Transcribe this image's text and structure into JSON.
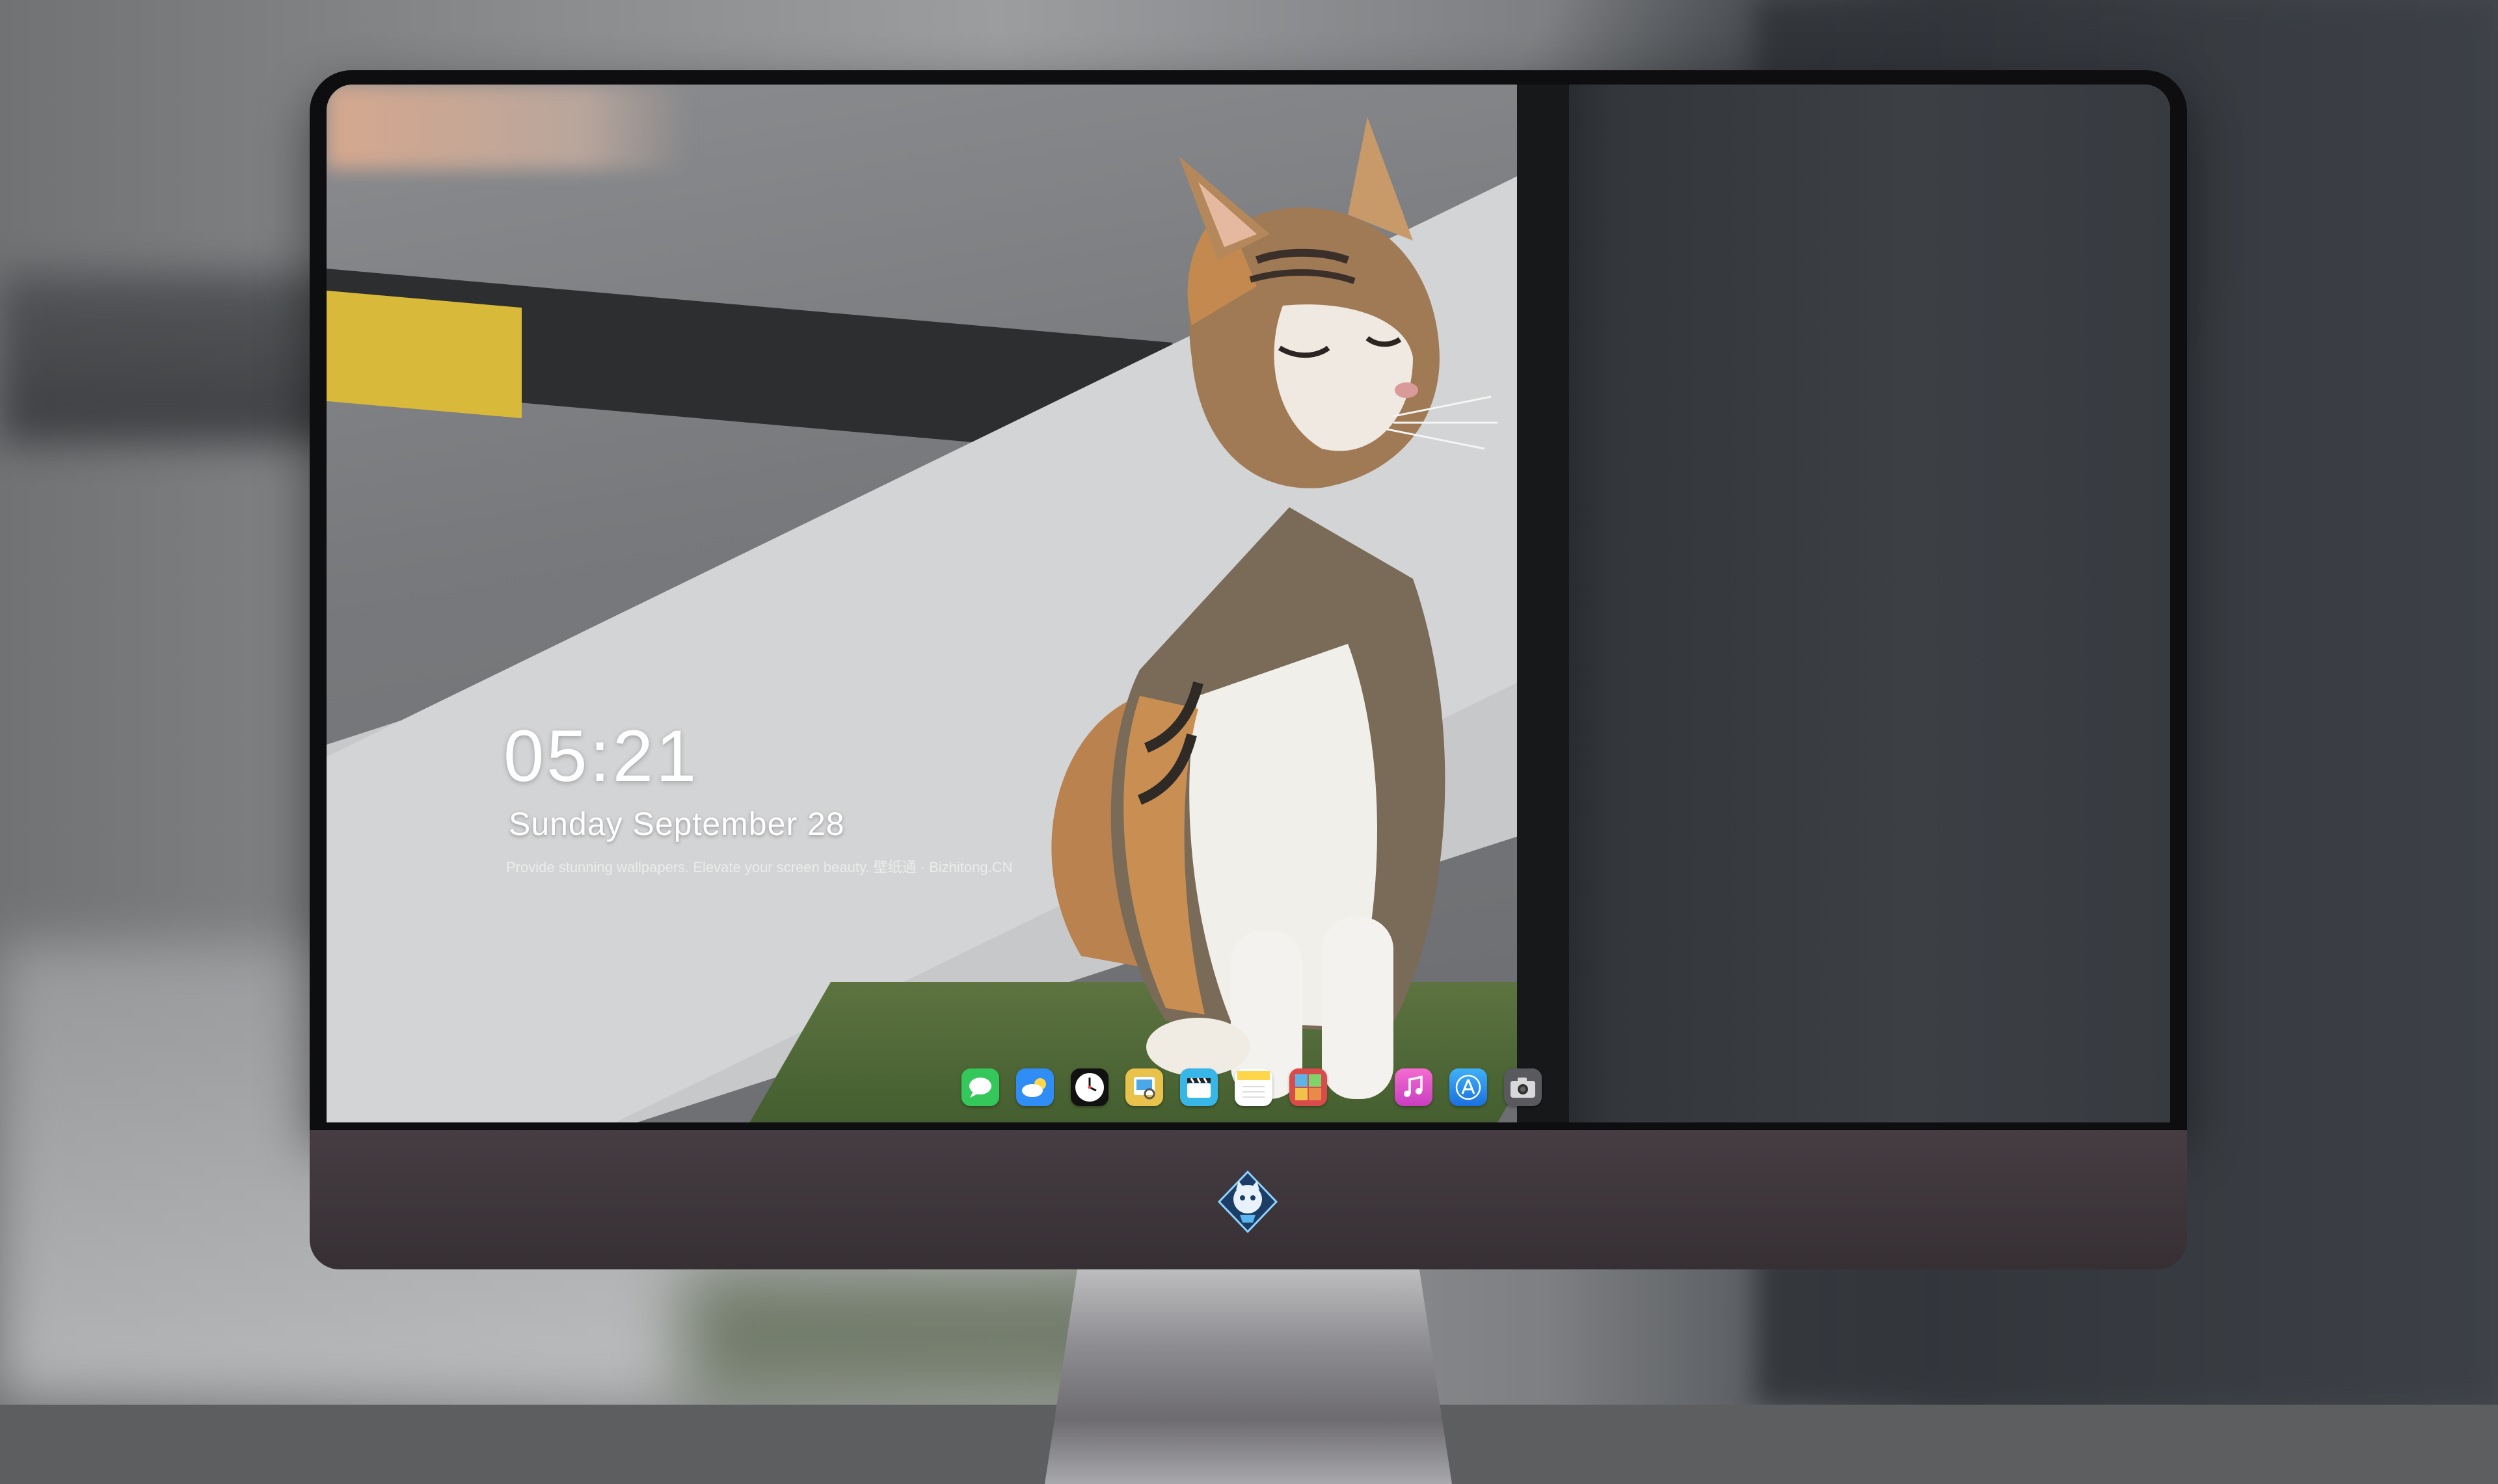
{
  "lockscreen": {
    "time": "05:21",
    "date": "Sunday September  28",
    "tagline": "Provide stunning wallpapers. Elevate your screen beauty. 壁纸通 · Bizhitong.CN"
  },
  "dock": {
    "apps": [
      {
        "name": "Messages",
        "icon": "messages-icon",
        "color": "#34c759"
      },
      {
        "name": "Weather",
        "icon": "weather-icon",
        "color": "#2f8df5"
      },
      {
        "name": "Clock",
        "icon": "clock-icon",
        "color": "#111111"
      },
      {
        "name": "Preview",
        "icon": "preview-icon",
        "color": "#e8c24a"
      },
      {
        "name": "Clips",
        "icon": "clips-icon",
        "color": "#38b6e8"
      },
      {
        "name": "Notes",
        "icon": "notes-icon",
        "color": "#ffd54a"
      },
      {
        "name": "Photo Booth",
        "icon": "photobooth-icon",
        "color": "#d94b4b"
      },
      {
        "name": "Music",
        "icon": "music-icon",
        "color": "#e454b8"
      },
      {
        "name": "App Store",
        "icon": "appstore-icon",
        "color": "#1f8cf0"
      },
      {
        "name": "Camera",
        "icon": "camera-icon",
        "color": "#5a5a5e"
      }
    ]
  },
  "colors": {
    "bezel": "#0e0e10",
    "chin": "#3e373c",
    "text": "#ffffff"
  }
}
